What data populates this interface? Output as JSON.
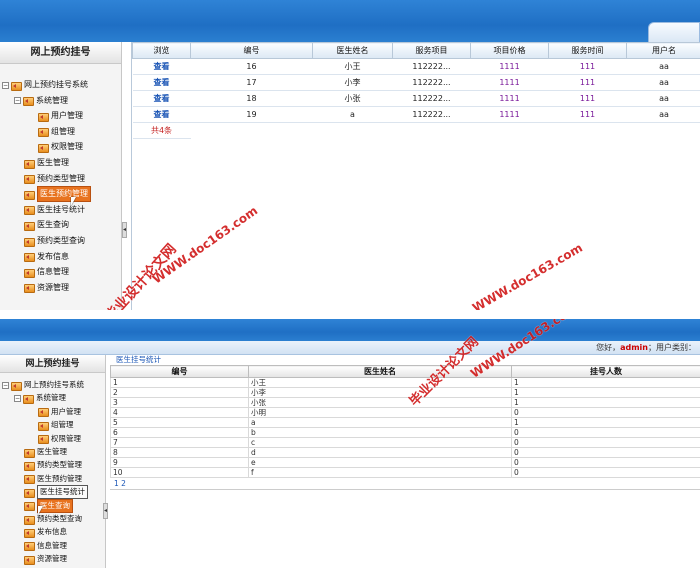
{
  "screen1": {
    "sidebar": {
      "title": "网上预约挂号",
      "root": "网上预约挂号系统",
      "group": "系统管理",
      "sub_items": [
        "用户管理",
        "组管理",
        "权限管理"
      ],
      "items": [
        "医生管理",
        "预约类型管理",
        "医生预约管理",
        "医生挂号统计",
        "医生查询",
        "预约类型查询",
        "发布信息",
        "信息管理",
        "资源管理"
      ],
      "selected": "医生预约管理"
    },
    "table": {
      "headers": [
        "浏览",
        "编号",
        "医生姓名",
        "服务项目",
        "项目价格",
        "服务时间",
        "用户名"
      ],
      "rows": [
        [
          "查看",
          "16",
          "小王",
          "112222...",
          "1111",
          "111",
          "aa"
        ],
        [
          "查看",
          "17",
          "小李",
          "112222...",
          "1111",
          "111",
          "aa"
        ],
        [
          "查看",
          "18",
          "小张",
          "112222...",
          "1111",
          "111",
          "aa"
        ],
        [
          "查看",
          "19",
          "a",
          "112222...",
          "1111",
          "111",
          "aa"
        ]
      ],
      "total": "共4条"
    },
    "watermark": {
      "line1": "毕业设计论文网",
      "line2": "WWW.doc163.com",
      "line3": "WWW.doc163.com"
    }
  },
  "screen2": {
    "userbar": {
      "greeting": "您好，",
      "user": "admin",
      "suffix": "；用户类别："
    },
    "sidebar": {
      "title": "网上预约挂号",
      "root": "网上预约挂号系统",
      "group": "系统管理",
      "sub_items": [
        "用户管理",
        "组管理",
        "权限管理"
      ],
      "items": [
        "医生管理",
        "预约类型管理",
        "医生预约管理",
        "医生挂号统计",
        "医生查询",
        "预约类型查询",
        "发布信息",
        "信息管理",
        "资源管理"
      ],
      "selected": "医生查询",
      "highlighted": "医生挂号统计"
    },
    "breadcrumb": "医生挂号统计",
    "table": {
      "headers": [
        "编号",
        "医生姓名",
        "挂号人数"
      ],
      "rows": [
        [
          "1",
          "小王",
          "1"
        ],
        [
          "2",
          "小李",
          "1"
        ],
        [
          "3",
          "小张",
          "1"
        ],
        [
          "4",
          "小明",
          "0"
        ],
        [
          "5",
          "a",
          "1"
        ],
        [
          "6",
          "b",
          "0"
        ],
        [
          "7",
          "c",
          "0"
        ],
        [
          "8",
          "d",
          "0"
        ],
        [
          "9",
          "e",
          "0"
        ],
        [
          "10",
          "f",
          "0"
        ]
      ],
      "pager": "1 2"
    },
    "watermark": {
      "line1": "毕业设计论文网",
      "line2": "WWW.doc163.com"
    }
  }
}
